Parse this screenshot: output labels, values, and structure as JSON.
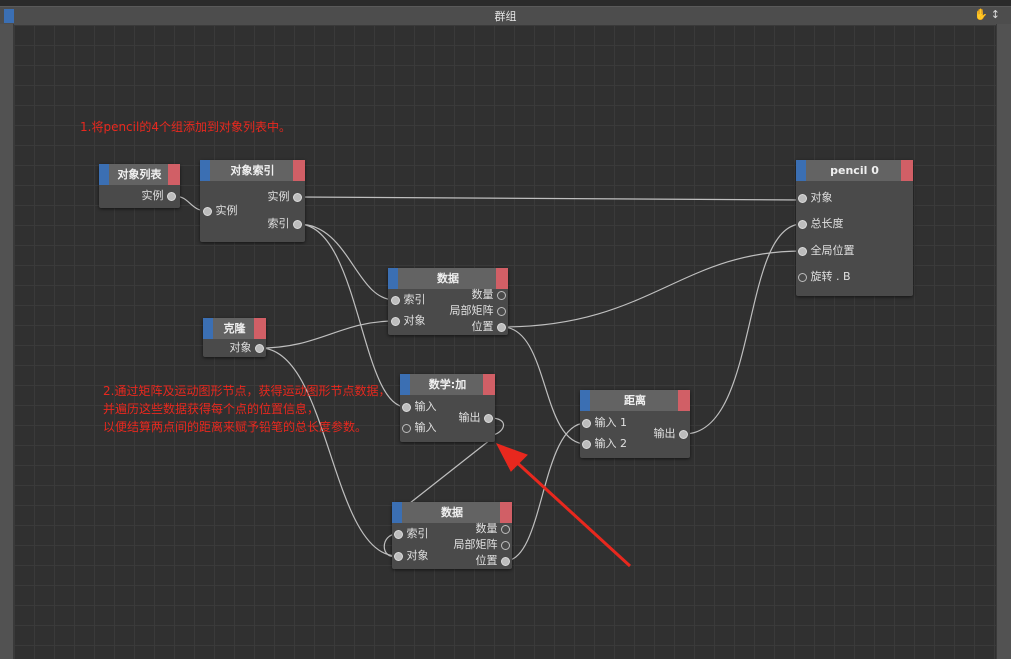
{
  "window": {
    "title": "群组",
    "icons": [
      "hand-icon",
      "vertical-resize-icon"
    ]
  },
  "annotations": [
    "1.将pencil的4个组添加到对象列表中。",
    "2.通过矩阵及运动图形节点，获得运动图形节点数据，",
    "并遍历这些数据获得每个点的位置信息，",
    "以便结算两点间的距离来赋予铅笔的总长度参数。"
  ],
  "nodes": {
    "object_list": {
      "title": "对象列表",
      "outputs": [
        "实例"
      ]
    },
    "object_index": {
      "title": "对象索引",
      "inputs": [
        "实例"
      ],
      "outputs": [
        "实例",
        "索引"
      ]
    },
    "clone": {
      "title": "克隆",
      "outputs": [
        "对象"
      ]
    },
    "data_top": {
      "title": "数据",
      "inputs": [
        "索引",
        "对象"
      ],
      "outputs": [
        "数量",
        "局部矩阵",
        "位置"
      ]
    },
    "math_add": {
      "title": "数学:加",
      "inputs": [
        "输入",
        "输入"
      ],
      "outputs": [
        "输出"
      ]
    },
    "data_bottom": {
      "title": "数据",
      "inputs": [
        "索引",
        "对象"
      ],
      "outputs": [
        "数量",
        "局部矩阵",
        "位置"
      ]
    },
    "distance": {
      "title": "距离",
      "inputs": [
        "输入 1",
        "输入 2"
      ],
      "outputs": [
        "输出"
      ]
    },
    "pencil": {
      "title": "pencil 0",
      "inputs": [
        "对象",
        "总长度",
        "全局位置",
        "旋转 . B"
      ]
    }
  },
  "colors": {
    "accent_blue": "#3b6fb3",
    "accent_red": "#d15f66",
    "annotation_red": "#e8281e",
    "wire": "#bfbfbf"
  }
}
